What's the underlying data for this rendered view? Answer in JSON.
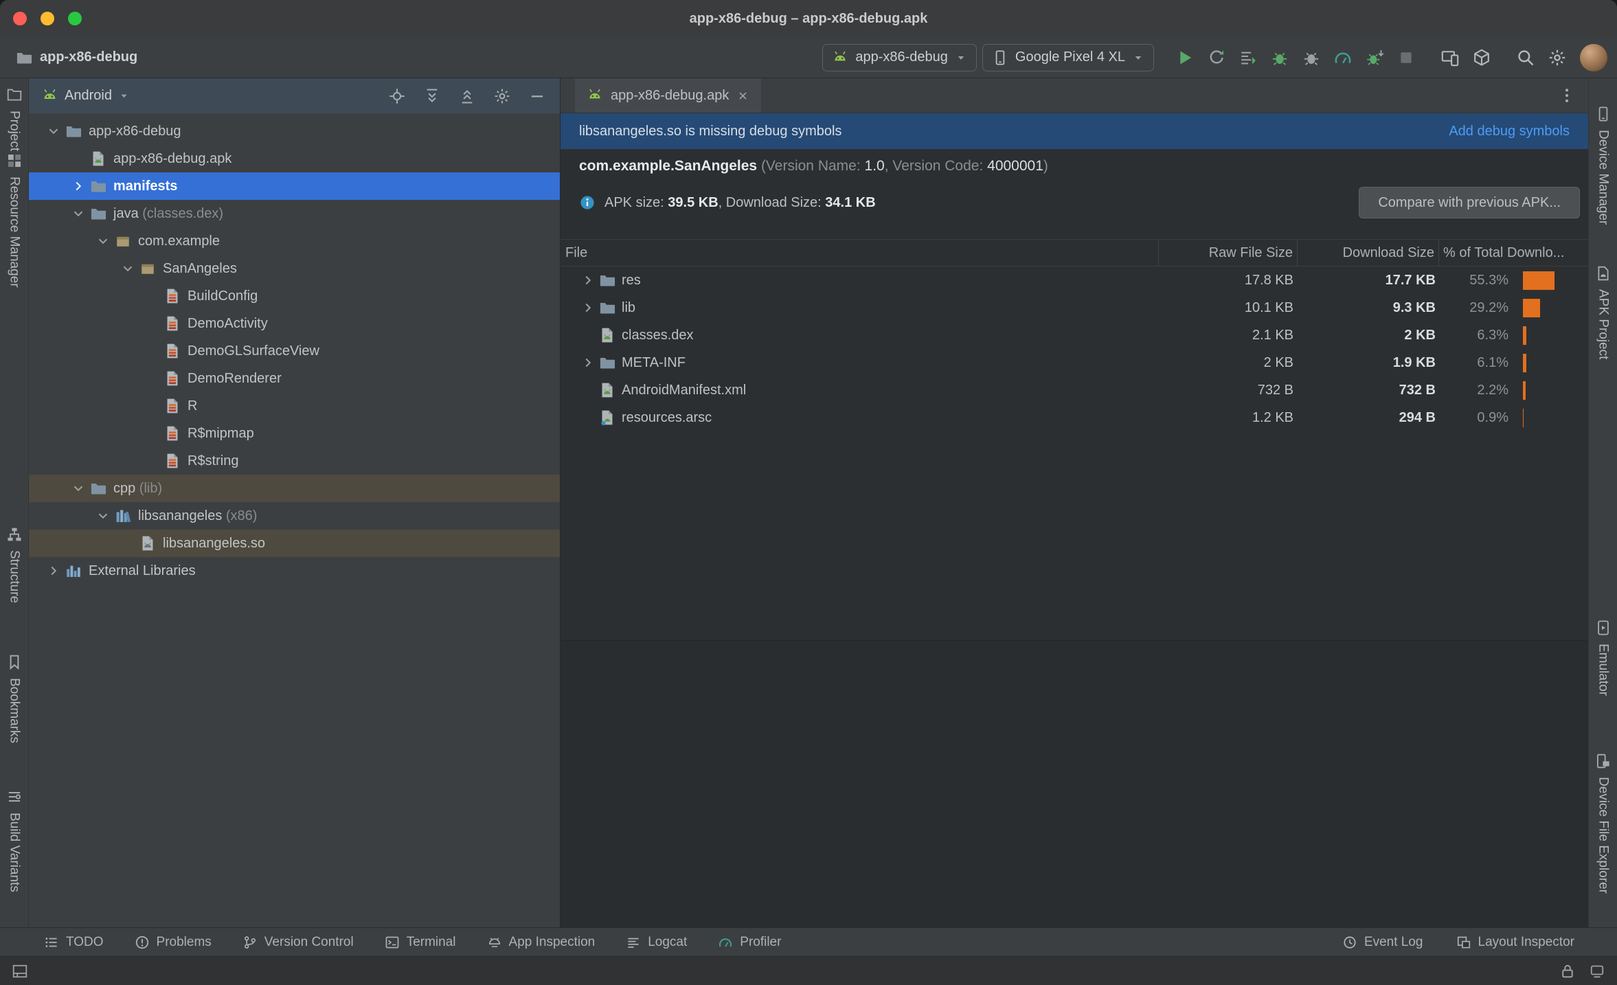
{
  "window": {
    "title": "app-x86-debug – app-x86-debug.apk",
    "project_name": "app-x86-debug"
  },
  "toolbar": {
    "run_config": "app-x86-debug",
    "device": "Google Pixel 4 XL"
  },
  "left_strip": [
    {
      "label": "Project",
      "icon": "project-tool"
    },
    {
      "label": "Resource Manager",
      "icon": "resource-manager"
    },
    {
      "label": "Structure",
      "icon": "structure"
    },
    {
      "label": "Bookmarks",
      "icon": "bookmarks"
    },
    {
      "label": "Build Variants",
      "icon": "build-variants"
    }
  ],
  "right_strip": [
    {
      "label": "Device Manager",
      "icon": "device-manager"
    },
    {
      "label": "APK Project",
      "icon": "apk-tool"
    },
    {
      "label": "Emulator",
      "icon": "emulator"
    },
    {
      "label": "Device File Explorer",
      "icon": "device-file-explorer"
    }
  ],
  "project_panel": {
    "view_selector": "Android",
    "tree": [
      {
        "label": "app-x86-debug",
        "level": 0,
        "chevron": "open",
        "icon": "folder"
      },
      {
        "label": "app-x86-debug.apk",
        "level": 1,
        "icon": "apk-file"
      },
      {
        "label": "manifests",
        "level": 1,
        "chevron": "closed",
        "icon": "folder",
        "selected": true,
        "bold": true
      },
      {
        "label": "java",
        "suffix": " (classes.dex)",
        "level": 1,
        "chevron": "open",
        "icon": "folder"
      },
      {
        "label": "com.example",
        "level": 2,
        "chevron": "open",
        "icon": "package"
      },
      {
        "label": "SanAngeles",
        "level": 3,
        "chevron": "open",
        "icon": "package"
      },
      {
        "label": "BuildConfig",
        "level": 4,
        "icon": "class"
      },
      {
        "label": "DemoActivity",
        "level": 4,
        "icon": "class"
      },
      {
        "label": "DemoGLSurfaceView",
        "level": 4,
        "icon": "class"
      },
      {
        "label": "DemoRenderer",
        "level": 4,
        "icon": "class"
      },
      {
        "label": "R",
        "level": 4,
        "icon": "class"
      },
      {
        "label": "R$mipmap",
        "level": 4,
        "icon": "class"
      },
      {
        "label": "R$string",
        "level": 4,
        "icon": "class"
      },
      {
        "label": "cpp",
        "suffix": " (lib)",
        "level": 1,
        "chevron": "open",
        "icon": "folder",
        "highlight": true
      },
      {
        "label": "libsanangeles",
        "suffix": " (x86)",
        "level": 2,
        "chevron": "open",
        "icon": "library"
      },
      {
        "label": "libsanangeles.so",
        "level": 3,
        "icon": "so-file",
        "highlight": true
      },
      {
        "label": "External Libraries",
        "level": 0,
        "chevron": "closed",
        "icon": "external-libraries"
      }
    ]
  },
  "editor": {
    "tab": "app-x86-debug.apk",
    "banner": {
      "message": "libsanangeles.so is missing debug symbols",
      "action": "Add debug symbols"
    },
    "package_line": {
      "package": "com.example.SanAngeles",
      "version_name_label": " (Version Name: ",
      "version_name": "1.0",
      "version_code_label": ", Version Code: ",
      "version_code": "4000001",
      "close": ")"
    },
    "size_line": {
      "prefix": "APK size: ",
      "apk_size": "39.5 KB",
      "mid": ", Download Size: ",
      "download_size": "34.1 KB"
    },
    "compare_button": "Compare with previous APK...",
    "table": {
      "columns": [
        "File",
        "Raw File Size",
        "Download Size",
        "% of Total Downlo..."
      ],
      "rows": [
        {
          "file": "res",
          "icon": "folder",
          "expandable": true,
          "raw": "17.8 KB",
          "download": "17.7 KB",
          "percent": "55.3%"
        },
        {
          "file": "lib",
          "icon": "folder",
          "expandable": true,
          "raw": "10.1 KB",
          "download": "9.3 KB",
          "percent": "29.2%"
        },
        {
          "file": "classes.dex",
          "icon": "dex-file",
          "expandable": false,
          "raw": "2.1 KB",
          "download": "2 KB",
          "percent": "6.3%"
        },
        {
          "file": "META-INF",
          "icon": "folder",
          "expandable": true,
          "raw": "2 KB",
          "download": "1.9 KB",
          "percent": "6.1%"
        },
        {
          "file": "AndroidManifest.xml",
          "icon": "manifest-file",
          "expandable": false,
          "raw": "732 B",
          "download": "732 B",
          "percent": "2.2%"
        },
        {
          "file": "resources.arsc",
          "icon": "arsc-file",
          "expandable": false,
          "raw": "1.2 KB",
          "download": "294 B",
          "percent": "0.9%"
        }
      ]
    }
  },
  "status_bar": {
    "left": [
      {
        "label": "TODO",
        "icon": "todo"
      },
      {
        "label": "Problems",
        "icon": "problems"
      },
      {
        "label": "Version Control",
        "icon": "version-control"
      },
      {
        "label": "Terminal",
        "icon": "terminal"
      },
      {
        "label": "App Inspection",
        "icon": "app-inspection"
      },
      {
        "label": "Logcat",
        "icon": "logcat"
      },
      {
        "label": "Profiler",
        "icon": "profiler-gauge"
      }
    ],
    "right": [
      {
        "label": "Event Log",
        "icon": "event-log"
      },
      {
        "label": "Layout Inspector",
        "icon": "layout-inspector"
      }
    ]
  },
  "colors": {
    "selection_blue": "#3570d6",
    "modified_highlight": "#4e4a3f",
    "banner_blue": "#254a75",
    "link_blue": "#4d9bf8",
    "percent_bar_orange": "#e2701e",
    "android_green": "#8fc14e"
  }
}
